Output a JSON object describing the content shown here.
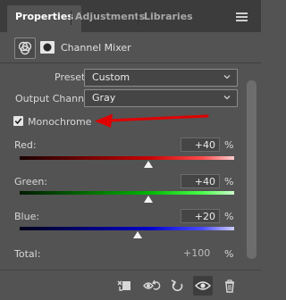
{
  "tabs": [
    {
      "label": "Properties",
      "active": true
    },
    {
      "label": "Adjustments",
      "active": false
    },
    {
      "label": "Libraries",
      "active": false
    }
  ],
  "panel_header": {
    "title": "Channel Mixer"
  },
  "preset": {
    "label": "Preset:",
    "value": "Custom"
  },
  "output_channel": {
    "label": "Output Channel:",
    "value": "Gray"
  },
  "monochrome": {
    "label": "Monochrome",
    "checked": true
  },
  "channels": [
    {
      "label": "Red:",
      "value": "+40",
      "unit": "%",
      "level_percent": 40,
      "color": "#e60000"
    },
    {
      "label": "Green:",
      "value": "+40",
      "unit": "%",
      "level_percent": 40,
      "color": "#00c800"
    },
    {
      "label": "Blue:",
      "value": "+20",
      "unit": "%",
      "level_percent": 20,
      "color": "#0000e6"
    }
  ],
  "total": {
    "label": "Total:",
    "value": "+100",
    "unit": "%"
  },
  "annotation": {
    "arrow_color": "#e00000"
  },
  "toolbar": {
    "icons": [
      "clip-to-layer-icon",
      "view-previous-state-icon",
      "reset-icon",
      "visibility-eye-icon",
      "trash-icon"
    ]
  }
}
